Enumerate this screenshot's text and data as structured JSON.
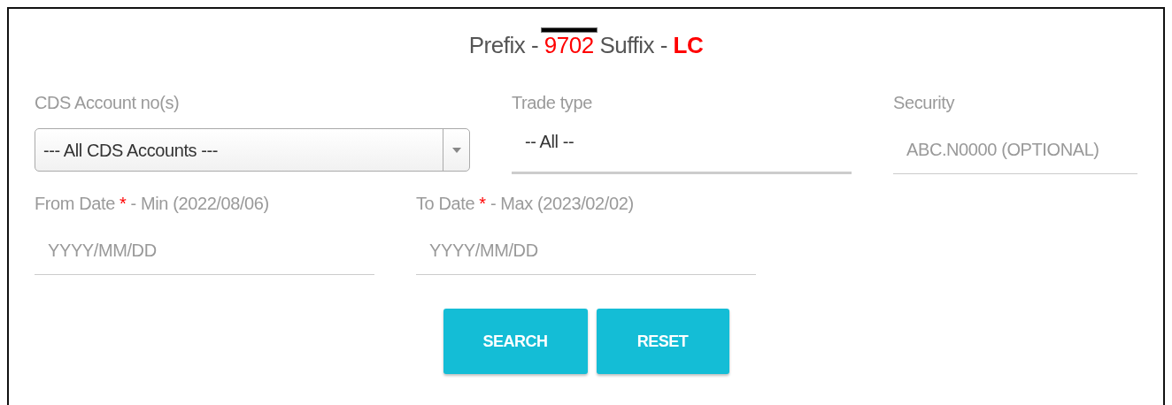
{
  "title": {
    "prefix_label": "Prefix -",
    "account_number": "9702",
    "redacted": true,
    "suffix_label": "Suffix -",
    "suffix": "LC"
  },
  "rows": [
    [
      {
        "kind": "select",
        "label": "CDS Account no(s)",
        "value": "--- All CDS Accounts ---"
      },
      {
        "kind": "underline-select",
        "label": "Trade type",
        "value": "-- All --"
      },
      {
        "kind": "text",
        "label": "Security",
        "placeholder": "ABC.N0000 (OPTIONAL)"
      }
    ],
    [
      {
        "kind": "text",
        "label": "From Date",
        "required_mark": "*",
        "hint": "- Min (2022/08/06)",
        "placeholder": "YYYY/MM/DD"
      },
      {
        "kind": "text",
        "label": "To Date",
        "required_mark": "*",
        "hint": "- Max (2023/02/02)",
        "placeholder": "YYYY/MM/DD"
      }
    ]
  ],
  "buttons": [
    {
      "label": "SEARCH"
    },
    {
      "label": "RESET"
    }
  ]
}
